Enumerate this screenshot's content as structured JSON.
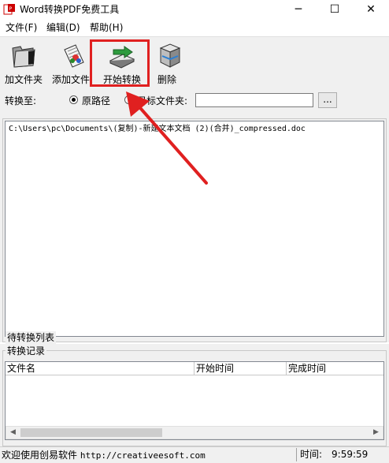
{
  "window": {
    "title": "Word转换PDF免费工具",
    "minimize": "─",
    "maximize": "☐",
    "close": "✕"
  },
  "menu": [
    "文件(F)",
    "编辑(D)",
    "帮助(H)"
  ],
  "toolbar": {
    "add_folder": "加文件夹",
    "add_file": "添加文件",
    "start_convert": "开始转换",
    "delete": "删除"
  },
  "options": {
    "convert_to_label": "转换至:",
    "original_path_label": "原路径",
    "target_folder_label": "目标文件夹:",
    "selected": "original_path",
    "target_folder_value": "",
    "browse_label": "..."
  },
  "pending_list": {
    "title": "待转换列表",
    "items": [
      "C:\\Users\\pc\\Documents\\(复制)-新建文本文档 (2)(合并)_compressed.doc"
    ]
  },
  "records": {
    "title": "转换记录",
    "columns": [
      "文件名",
      "开始时间",
      "完成时间"
    ],
    "rows": []
  },
  "statusbar": {
    "left_text": "欢迎使用创易软件 ",
    "url": "http://creativeesoft.com",
    "time_label": "时间:",
    "time_value": "9:59:59"
  },
  "colors": {
    "highlight": "#e02020",
    "chrome": "#f0f0f0"
  }
}
